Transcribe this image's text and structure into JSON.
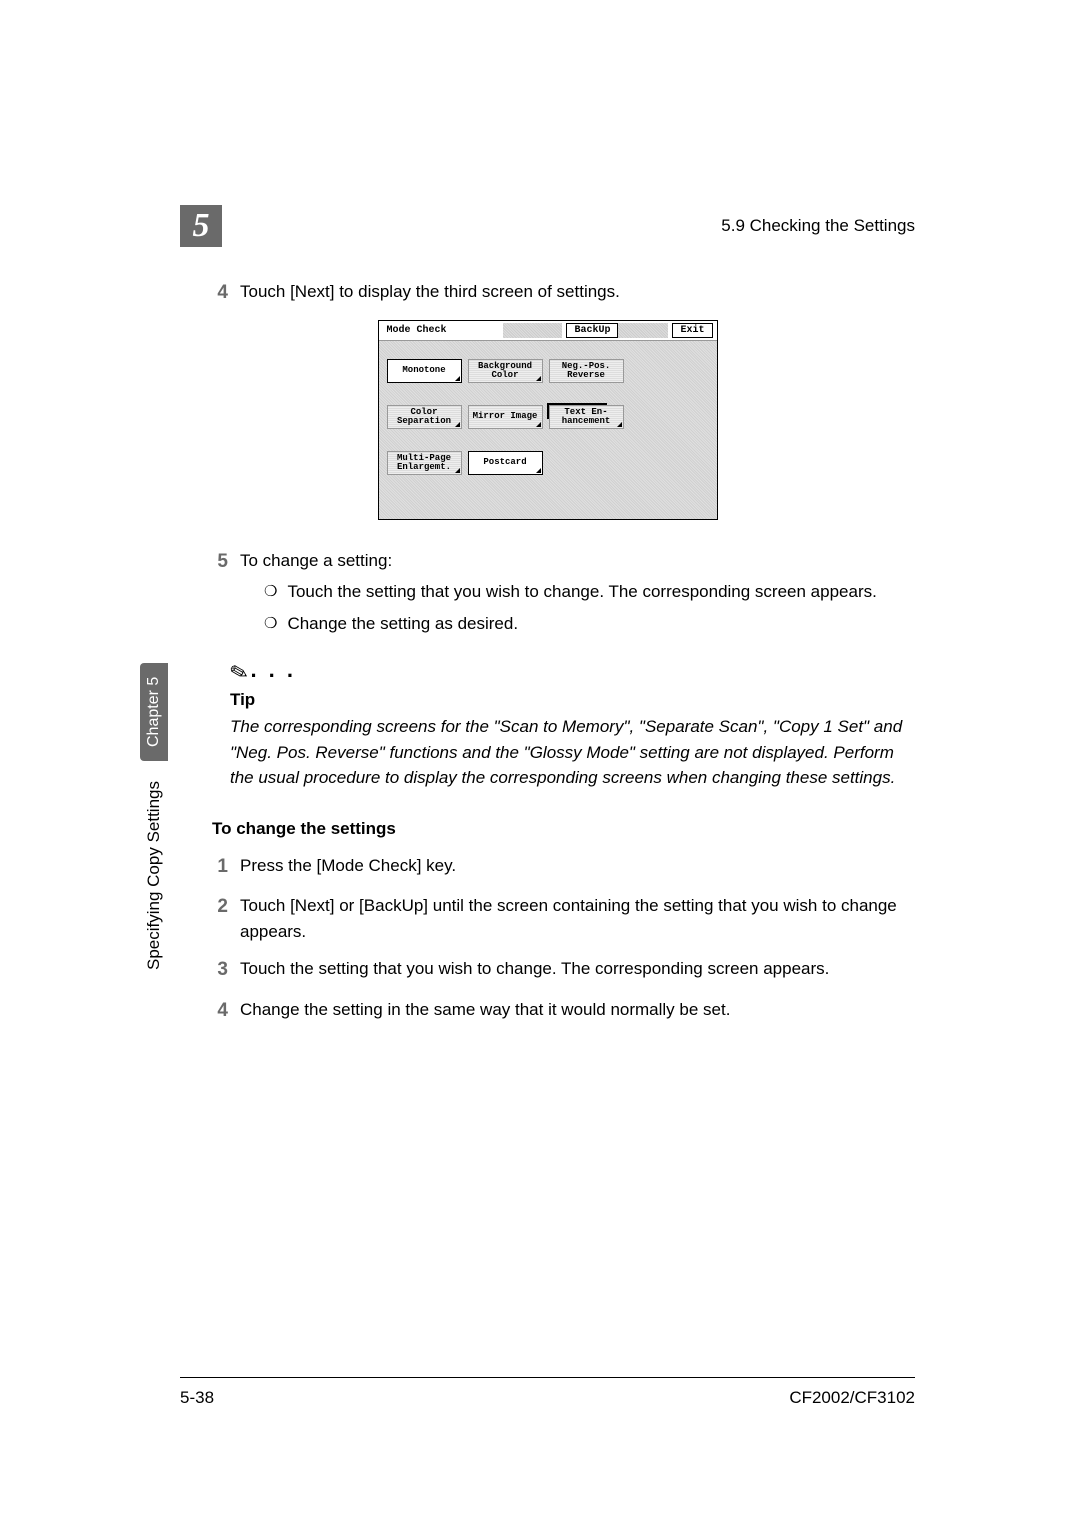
{
  "header": {
    "chapter_number": "5",
    "section_heading": "5.9 Checking the Settings"
  },
  "intro": {
    "step4_num": "4",
    "step4_text": "Touch [Next] to display the third screen of settings."
  },
  "figure": {
    "title": "Mode Check",
    "backup": "BackUp",
    "exit": "Exit",
    "row1": {
      "b1": "Monotone",
      "b2": "Background Color",
      "b3": "Neg.-Pos. Reverse"
    },
    "rowmid_dark": "",
    "row2": {
      "b1": "Color Separation",
      "b2": "Mirror Image",
      "b3": "Text En- hancement"
    },
    "row3": {
      "b1": "Multi-Page Enlargemt.",
      "b2": "Postcard"
    }
  },
  "step5": {
    "num": "5",
    "text": "To change a setting:",
    "bullet1": "Touch the setting that you wish to change. The corresponding screen appears.",
    "bullet2": "Change the setting as desired."
  },
  "tip": {
    "title": "Tip",
    "text": "The corresponding screens for the \"Scan to Memory\", \"Separate Scan\", \"Copy 1 Set\" and \"Neg. Pos. Reverse\" functions and the \"Glossy Mode\" setting are not displayed. Perform the usual procedure to display the corresponding screens when changing these settings."
  },
  "section2": {
    "heading": "To change the settings",
    "s1_num": "1",
    "s1_text": "Press the [Mode Check] key.",
    "s2_num": "2",
    "s2_text": "Touch [Next] or [BackUp] until the screen containing the setting that you wish to change appears.",
    "s3_num": "3",
    "s3_text": "Touch the setting that you wish to change. The corresponding screen appears.",
    "s4_num": "4",
    "s4_text": "Change the setting in the same way that it would normally be set."
  },
  "sidebar": {
    "text": "Specifying Copy Settings",
    "chapter": "Chapter 5"
  },
  "footer": {
    "page": "5-38",
    "model": "CF2002/CF3102"
  }
}
